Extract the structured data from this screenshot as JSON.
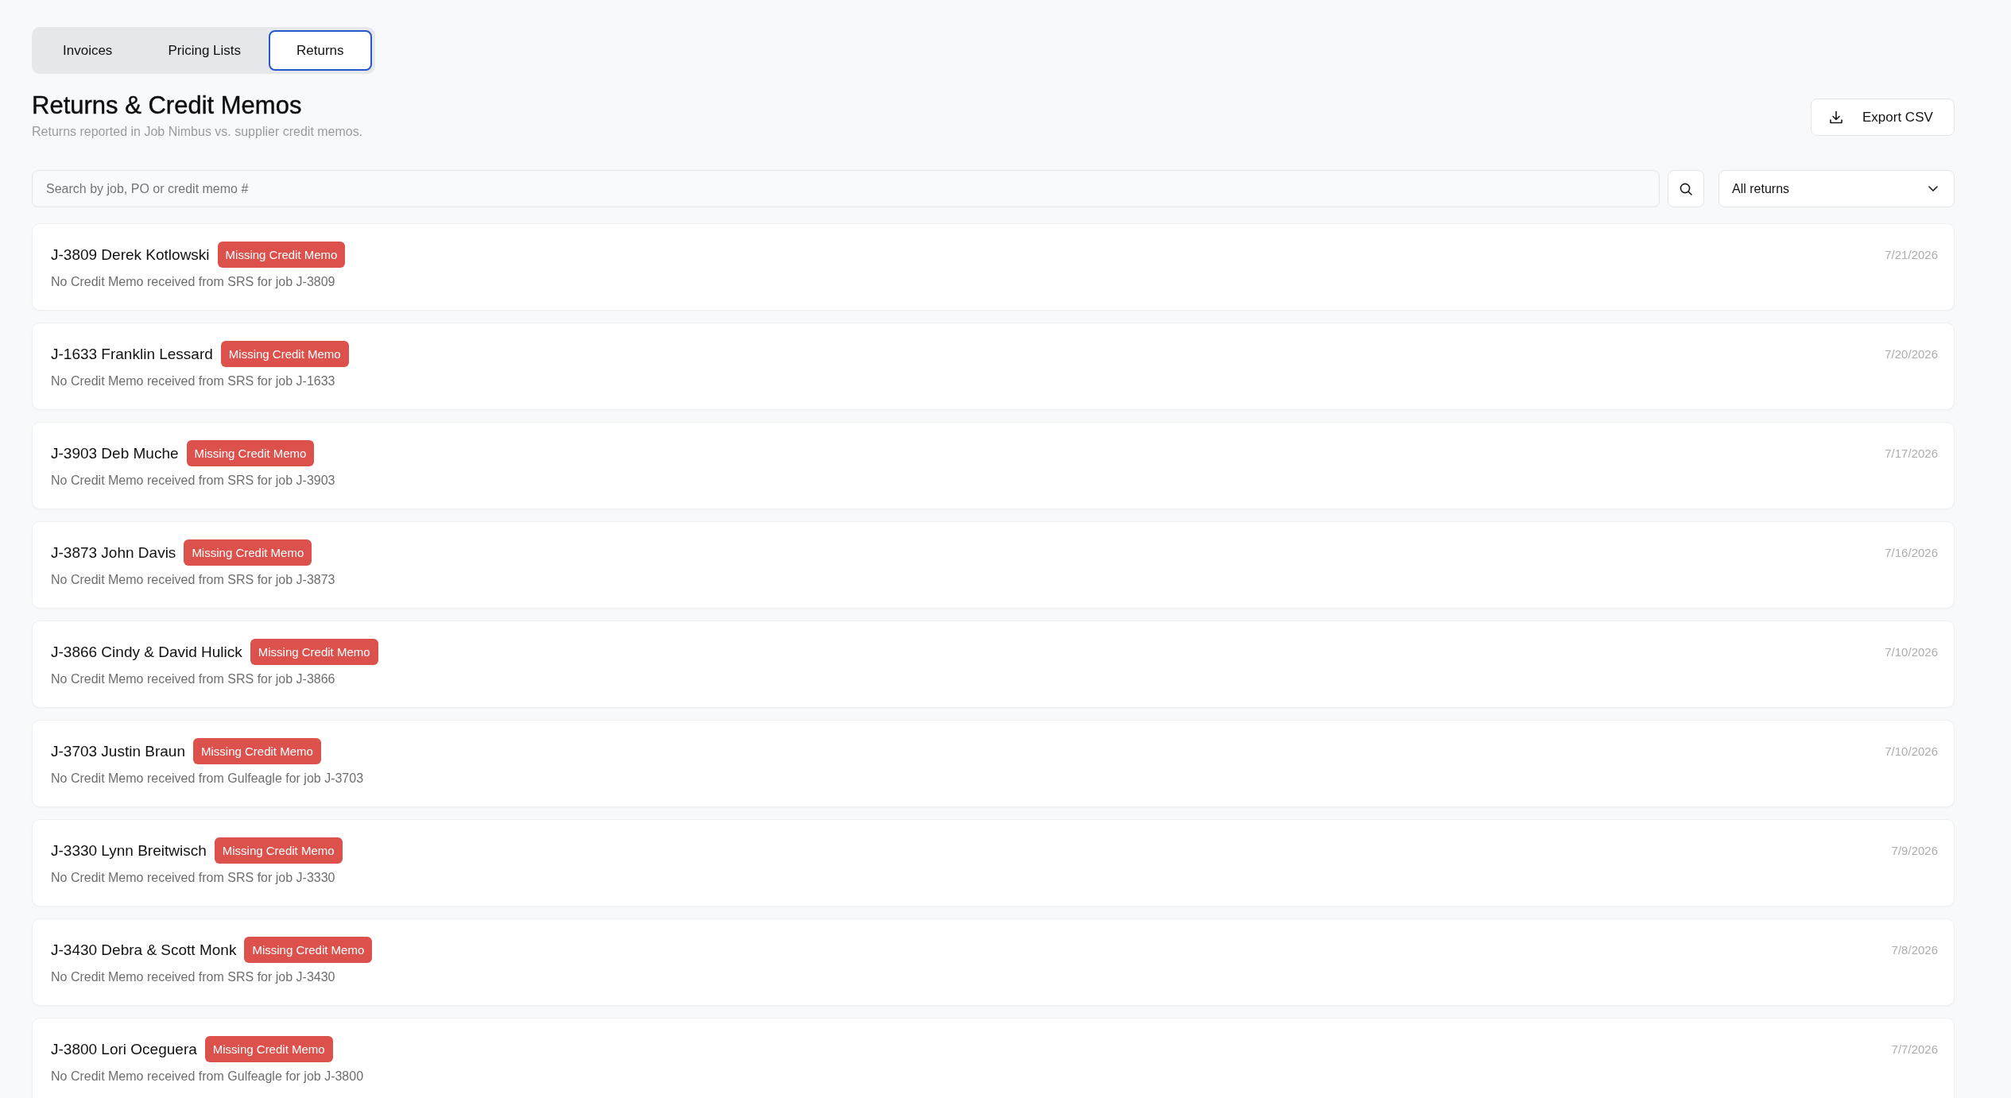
{
  "tabs": [
    {
      "label": "Invoices",
      "selected": false
    },
    {
      "label": "Pricing Lists",
      "selected": false
    },
    {
      "label": "Returns",
      "selected": true
    }
  ],
  "header": {
    "title": "Returns & Credit Memos",
    "subtitle": "Returns reported in Job Nimbus vs. supplier credit memos.",
    "export_button": "Export CSV"
  },
  "search": {
    "placeholder": "Search by job, PO or credit memo #"
  },
  "filter": {
    "value": "All returns"
  },
  "returns": [
    {
      "title": "J-3809 Derek Kotlowski",
      "badge": "Missing Credit Memo",
      "description": "No Credit Memo received from SRS for job J-3809",
      "date": "7/21/2026"
    },
    {
      "title": "J-1633 Franklin Lessard",
      "badge": "Missing Credit Memo",
      "description": "No Credit Memo received from SRS for job J-1633",
      "date": "7/20/2026"
    },
    {
      "title": "J-3903 Deb Muche",
      "badge": "Missing Credit Memo",
      "description": "No Credit Memo received from SRS for job J-3903",
      "date": "7/17/2026"
    },
    {
      "title": "J-3873 John Davis",
      "badge": "Missing Credit Memo",
      "description": "No Credit Memo received from SRS for job J-3873",
      "date": "7/16/2026"
    },
    {
      "title": "J-3866 Cindy & David Hulick",
      "badge": "Missing Credit Memo",
      "description": "No Credit Memo received from SRS for job J-3866",
      "date": "7/10/2026"
    },
    {
      "title": "J-3703 Justin Braun",
      "badge": "Missing Credit Memo",
      "description": "No Credit Memo received from Gulfeagle for job J-3703",
      "date": "7/10/2026"
    },
    {
      "title": "J-3330 Lynn Breitwisch",
      "badge": "Missing Credit Memo",
      "description": "No Credit Memo received from SRS for job J-3330",
      "date": "7/9/2026"
    },
    {
      "title": "J-3430 Debra & Scott Monk",
      "badge": "Missing Credit Memo",
      "description": "No Credit Memo received from SRS for job J-3430",
      "date": "7/8/2026"
    },
    {
      "title": "J-3800 Lori Oceguera",
      "badge": "Missing Credit Memo",
      "description": "No Credit Memo received from Gulfeagle for job J-3800",
      "date": "7/7/2026"
    }
  ]
}
